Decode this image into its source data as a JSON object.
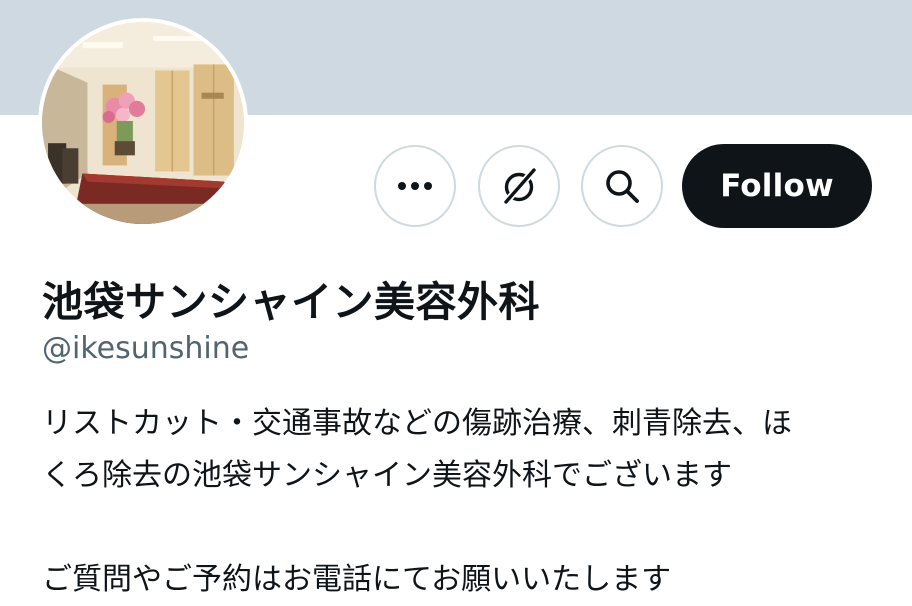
{
  "profile": {
    "display_name": "池袋サンシャイン美容外科",
    "handle": "@ikesunshine",
    "bio_line_1": "リストカット・交通事故などの傷跡治療、刺青除去、ほ",
    "bio_line_2": "くろ除去の池袋サンシャイン美容外科でございます",
    "bio_line_3": "ご質問やご予約はお電話にてお願いいたします"
  },
  "actions": {
    "more_icon": "more-horizontal-icon",
    "grok_icon": "grok-icon",
    "search_icon": "search-icon",
    "follow_label": "Follow"
  },
  "colors": {
    "banner": "#cfd9e2",
    "follow_bg": "#0f1419",
    "follow_text": "#ffffff",
    "handle": "#536471",
    "text": "#0f1419",
    "button_border": "#cfd9de"
  }
}
